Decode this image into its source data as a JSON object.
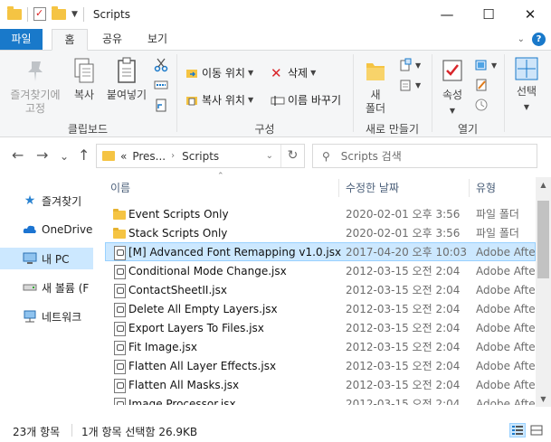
{
  "window": {
    "title": "Scripts",
    "minimize_glyph": "—",
    "maximize_glyph": "☐",
    "close_glyph": "✕"
  },
  "ribbon_tabs": [
    {
      "label": "파일"
    },
    {
      "label": "홈"
    },
    {
      "label": "공유"
    },
    {
      "label": "보기"
    }
  ],
  "ribbon": {
    "clipboard": {
      "pin_label_1": "즐겨찾기에",
      "pin_label_2": "고정",
      "copy_label": "복사",
      "paste_label": "붙여넣기",
      "group_label": "클립보드"
    },
    "organize": {
      "move_label": "이동 위치",
      "copy_to_label": "복사 위치",
      "delete_label": "삭제",
      "rename_label": "이름 바꾸기",
      "group_label": "구성"
    },
    "new": {
      "new_folder_label_1": "새",
      "new_folder_label_2": "폴더",
      "group_label": "새로 만들기"
    },
    "open": {
      "properties_label": "속성",
      "group_label": "열기"
    },
    "select": {
      "select_label": "선택"
    }
  },
  "address": {
    "prefix": "«",
    "crumb_1": "Pres...",
    "separator": "›",
    "crumb_2": "Scripts",
    "refresh_glyph": "↻"
  },
  "search": {
    "placeholder": "Scripts 검색",
    "icon_glyph": "⚲"
  },
  "nav": {
    "back_glyph": "←",
    "forward_glyph": "→",
    "recent_glyph": "⌄",
    "up_glyph": "↑",
    "items": [
      {
        "label": "즐겨찾기",
        "icon": "star-icon"
      },
      {
        "label": "OneDrive",
        "icon": "cloud-icon"
      },
      {
        "label": "내 PC",
        "icon": "computer-icon"
      },
      {
        "label": "새 볼륨 (F",
        "icon": "drive-icon"
      },
      {
        "label": "네트워크",
        "icon": "network-icon"
      }
    ]
  },
  "columns": {
    "name": "이름",
    "date": "수정한 날짜",
    "type": "유형"
  },
  "files": [
    {
      "name": "Event Scripts Only",
      "date": "2020-02-01 오후 3:56",
      "type": "파일 폴더",
      "kind": "folder"
    },
    {
      "name": "Stack Scripts Only",
      "date": "2020-02-01 오후 3:56",
      "type": "파일 폴더",
      "kind": "folder"
    },
    {
      "name": "[M] Advanced Font Remapping v1.0.jsx",
      "date": "2017-04-20 오후 10:03",
      "type": "Adobe After",
      "kind": "script",
      "selected": true
    },
    {
      "name": "Conditional Mode Change.jsx",
      "date": "2012-03-15 오전 2:04",
      "type": "Adobe After",
      "kind": "script"
    },
    {
      "name": "ContactSheetII.jsx",
      "date": "2012-03-15 오전 2:04",
      "type": "Adobe After",
      "kind": "script"
    },
    {
      "name": "Delete All Empty Layers.jsx",
      "date": "2012-03-15 오전 2:04",
      "type": "Adobe After",
      "kind": "script"
    },
    {
      "name": "Export Layers To Files.jsx",
      "date": "2012-03-15 오전 2:04",
      "type": "Adobe After",
      "kind": "script"
    },
    {
      "name": "Fit Image.jsx",
      "date": "2012-03-15 오전 2:04",
      "type": "Adobe After",
      "kind": "script"
    },
    {
      "name": "Flatten All Layer Effects.jsx",
      "date": "2012-03-15 오전 2:04",
      "type": "Adobe After",
      "kind": "script"
    },
    {
      "name": "Flatten All Masks.jsx",
      "date": "2012-03-15 오전 2:04",
      "type": "Adobe After",
      "kind": "script"
    },
    {
      "name": "Image Processor.jsx",
      "date": "2012-03-15 오전 2:04",
      "type": "Adobe After",
      "kind": "script"
    }
  ],
  "status": {
    "item_count": "23개 항목",
    "selection": "1개 항목 선택함 26.9KB"
  },
  "colors": {
    "accent": "#1979ca",
    "selection": "#cce8ff",
    "selection_border": "#99d1ff",
    "folder": "#f5c443"
  }
}
